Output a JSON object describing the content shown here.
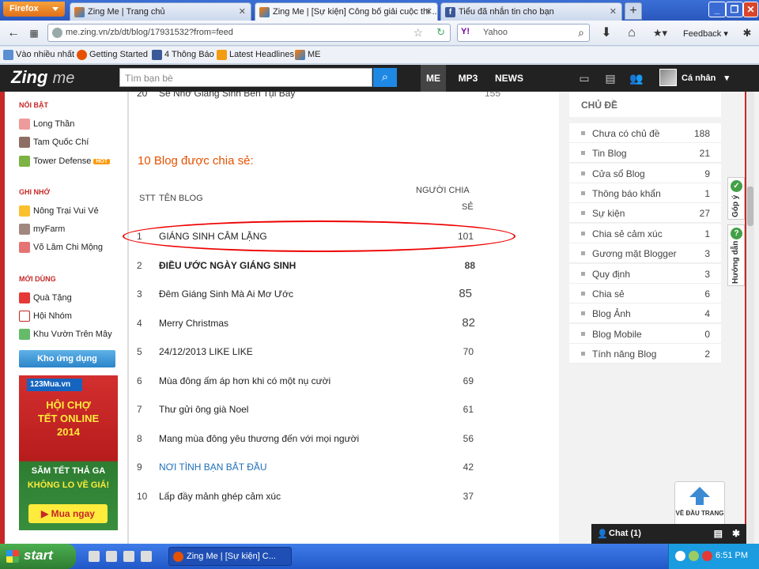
{
  "browser": {
    "menu_button": "Firefox",
    "tabs": [
      {
        "label": "Zing Me | Trang chủ",
        "active": false
      },
      {
        "label": "Zing Me | [Sự kiện] Công bố giải cuộc thi ...",
        "active": true
      },
      {
        "label": "Tiểu đã nhắn tin cho bạn",
        "active": false
      }
    ],
    "url": "me.zing.vn/zb/dt/blog/17931532?from=feed",
    "search_engine": "Yahoo",
    "search_placeholder": "Yahoo",
    "feedback_label": "Feedback",
    "bookmarks": [
      "Vào nhiều nhất",
      "Getting Started",
      "4 Thông Báo",
      "Latest Headlines",
      "ME"
    ]
  },
  "zing": {
    "logo_main": "Zing",
    "logo_sub": "me",
    "search_placeholder": "Tìm bạn bè",
    "nav": [
      "ME",
      "MP3",
      "NEWS"
    ],
    "user_label": "Cá nhân"
  },
  "left_sidebar": {
    "sections": [
      {
        "title": "NỔI BẬT",
        "items": [
          "Long Thần",
          "Tam Quốc Chí",
          "Tower Defense"
        ]
      },
      {
        "title": "GHI NHỚ",
        "items": [
          "Nông Trại Vui Vẻ",
          "myFarm",
          "Võ Lâm Chi Mộng"
        ]
      },
      {
        "title": "MỚI DÙNG",
        "items": [
          "Quà Tặng",
          "Hội Nhóm",
          "Khu Vườn Trên Mây"
        ]
      }
    ],
    "hot_badge": "HOT",
    "app_button": "Kho ứng dụng",
    "ad": {
      "logo": "123Mua.vn",
      "line1": "HỘI CHỢ",
      "line2": "TẾT ONLINE",
      "line3": "2014",
      "line4": "SĂM TẾT THẢ GA",
      "line5": "KHÔNG LO VỀ GIÁ!",
      "button": "Mua ngay"
    }
  },
  "content": {
    "prev_row": {
      "num": "20",
      "name": "Sẽ Nhớ Giáng Sinh Bên Tụi Bay",
      "count": "155"
    },
    "section_title": "10 Blog được chia sẻ:",
    "headers": {
      "stt": "STT",
      "name": "TÊN BLOG",
      "share_line1": "NGƯỜI CHIA",
      "share_line2": "SẺ"
    },
    "rows": [
      {
        "num": "1",
        "name": "GIÁNG SINH CÂM LẶNG",
        "count": "101",
        "style": "normal"
      },
      {
        "num": "2",
        "name": "ĐIỀU ƯỚC NGÀY GIÁNG SINH",
        "count": "88",
        "style": "bold"
      },
      {
        "num": "3",
        "name": "Đêm Giáng Sinh Mà Ai Mơ Ước",
        "count": "85",
        "style": "large"
      },
      {
        "num": "4",
        "name": "Merry Christmas",
        "count": "82",
        "style": "large"
      },
      {
        "num": "5",
        "name": "24/12/2013 LIKE LIKE",
        "count": "70",
        "style": "normal"
      },
      {
        "num": "6",
        "name": "Mùa đông ấm áp hơn khi có một nụ cười",
        "count": "69",
        "style": "normal"
      },
      {
        "num": "7",
        "name": "Thư gửi ông già Noel",
        "count": "61",
        "style": "normal"
      },
      {
        "num": "8",
        "name": "Mang mùa đông yêu thương đến với mọi người",
        "count": "56",
        "style": "normal"
      },
      {
        "num": "9",
        "name": "NƠI TÌNH BẠN BẮT ĐẦU",
        "count": "42",
        "style": "link"
      },
      {
        "num": "10",
        "name": "Lấp đầy mảnh ghép cảm xúc",
        "count": "37",
        "style": "normal"
      }
    ]
  },
  "right_sidebar": {
    "title": "CHỦ ĐỀ",
    "topics": [
      {
        "label": "Chưa có chủ đề",
        "count": "188"
      },
      {
        "label": "Tin Blog",
        "count": "21"
      },
      {
        "label": "Cửa sổ Blog",
        "count": "9"
      },
      {
        "label": "Thông báo khẩn",
        "count": "1"
      },
      {
        "label": "Sự kiện",
        "count": "27"
      },
      {
        "label": "Chia sẻ cảm xúc",
        "count": "1"
      },
      {
        "label": "Gương mặt Blogger",
        "count": "3"
      },
      {
        "label": "Quy định",
        "count": "3"
      },
      {
        "label": "Chia sẻ",
        "count": "6"
      },
      {
        "label": "Blog Ảnh",
        "count": "4"
      },
      {
        "label": "Blog Mobile",
        "count": "0"
      },
      {
        "label": "Tính năng Blog",
        "count": "2"
      }
    ]
  },
  "side_tabs": {
    "feedback": "Góp ý",
    "guide": "Hướng dẫn"
  },
  "back_to_top": "VỀ ĐẦU TRANG",
  "chat": {
    "label": "Chat (1)"
  },
  "taskbar": {
    "start": "start",
    "task": "Zing Me | [Sự kiện] C...",
    "clock": "6:51 PM"
  }
}
